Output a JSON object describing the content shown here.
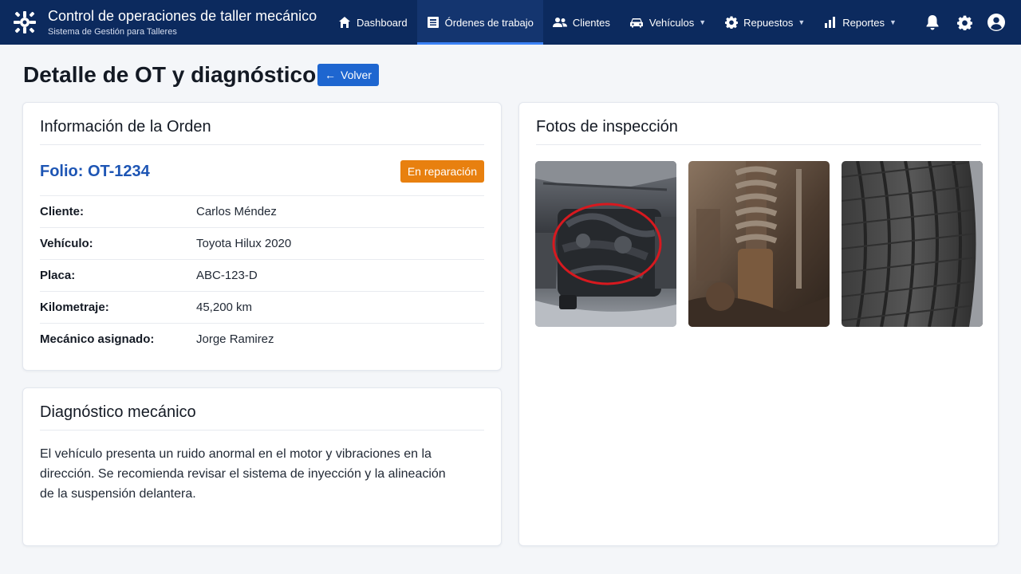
{
  "app": {
    "title": "Control de operaciones de taller mecánico",
    "subtitle": "Sistema de Gestión para Talleres"
  },
  "nav": [
    {
      "label": "Dashboard",
      "icon": "home-icon",
      "active": false,
      "dropdown": false
    },
    {
      "label": "Órdenes de trabajo",
      "icon": "list-icon",
      "active": true,
      "dropdown": false
    },
    {
      "label": "Clientes",
      "icon": "users-icon",
      "active": false,
      "dropdown": false
    },
    {
      "label": "Vehículos",
      "icon": "car-icon",
      "active": false,
      "dropdown": true
    },
    {
      "label": "Repuestos",
      "icon": "gear-icon",
      "active": false,
      "dropdown": true
    },
    {
      "label": "Reportes",
      "icon": "bar-chart-icon",
      "active": false,
      "dropdown": true
    }
  ],
  "top_icons": [
    "bell-icon",
    "settings-icon",
    "user-avatar-icon"
  ],
  "page": {
    "title": "Detalle de OT y diagnóstico",
    "back_label": "Volver"
  },
  "order": {
    "title": "Información de la Orden",
    "folio": "Folio: OT-1234",
    "status": "En reparación",
    "fields": [
      {
        "label": "Cliente:",
        "value": "Carlos Méndez"
      },
      {
        "label": "Vehículo:",
        "value": "Toyota Hilux 2020"
      },
      {
        "label": "Placa:",
        "value": "ABC-123-D"
      },
      {
        "label": "Kilometraje:",
        "value": "45,200 km"
      },
      {
        "label": "Mecánico asignado:",
        "value": "Jorge Ramirez"
      }
    ]
  },
  "diagnosis": {
    "title": "Diagnóstico mecánico",
    "text": "El vehículo presenta un ruido anormal en el motor y vibraciones en la dirección. Se recomienda revisar el sistema de inyección y la alineación de la suspensión delantera."
  },
  "photos": {
    "title": "Fotos de inspección",
    "items": [
      "engine-photo",
      "suspension-photo",
      "tire-photo"
    ]
  },
  "colors": {
    "topbar": "#0c2a5e",
    "accent": "#1e66d0",
    "folio": "#1d55b4",
    "status": "#e8800f"
  }
}
